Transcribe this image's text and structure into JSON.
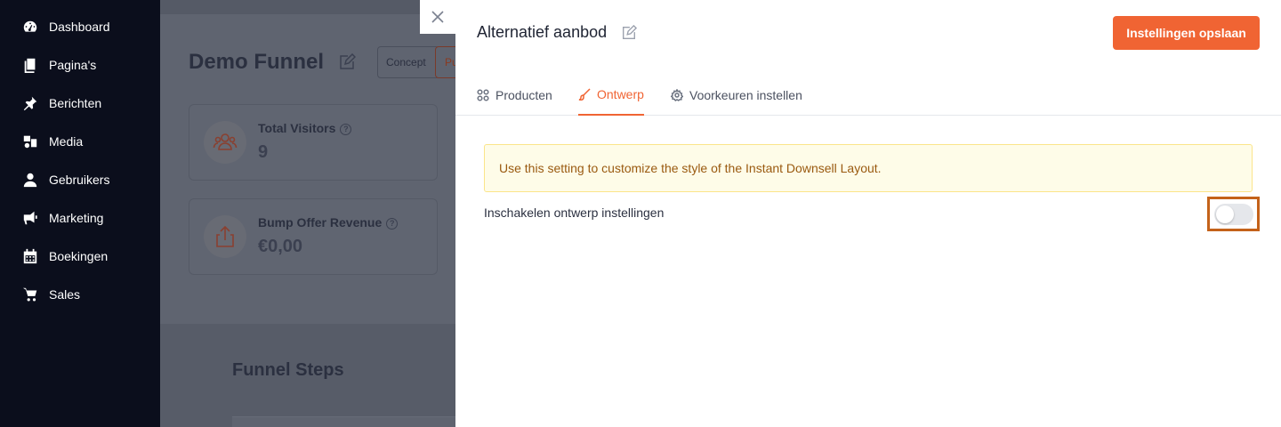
{
  "sidebar": {
    "items": [
      {
        "label": "Dashboard",
        "icon": "dashboard-icon"
      },
      {
        "label": "Pagina's",
        "icon": "pages-icon"
      },
      {
        "label": "Berichten",
        "icon": "pin-icon"
      },
      {
        "label": "Media",
        "icon": "media-icon"
      },
      {
        "label": "Gebruikers",
        "icon": "user-icon"
      },
      {
        "label": "Marketing",
        "icon": "megaphone-icon"
      },
      {
        "label": "Boekingen",
        "icon": "calendar-icon"
      },
      {
        "label": "Sales",
        "icon": "cart-icon"
      }
    ]
  },
  "background_page": {
    "title": "Demo Funnel",
    "status": "Concept",
    "status_2": "Pu",
    "cards": [
      {
        "label": "Total Visitors",
        "value": "9",
        "icon": "users-icon"
      },
      {
        "label": "Bump Offer Revenue",
        "value": "€0,00",
        "icon": "share-icon"
      }
    ],
    "section_title": "Funnel Steps"
  },
  "drawer": {
    "title": "Alternatief aanbod",
    "save_label": "Instellingen opslaan",
    "tabs": [
      {
        "label": "Producten",
        "icon": "products-icon",
        "active": false
      },
      {
        "label": "Ontwerp",
        "icon": "brush-icon",
        "active": true
      },
      {
        "label": "Voorkeuren instellen",
        "icon": "gear-icon",
        "active": false
      }
    ],
    "notice": "Use this setting to customize the style of the Instant Downsell Layout.",
    "toggle_label": "Inschakelen ontwerp instellingen",
    "toggle_on": false
  },
  "colors": {
    "accent": "#f06433",
    "sidebar_bg": "#0b0e1c",
    "notice_bg": "#fefce8",
    "notice_text": "#9a5a10",
    "highlight_border": "#c4621a"
  }
}
